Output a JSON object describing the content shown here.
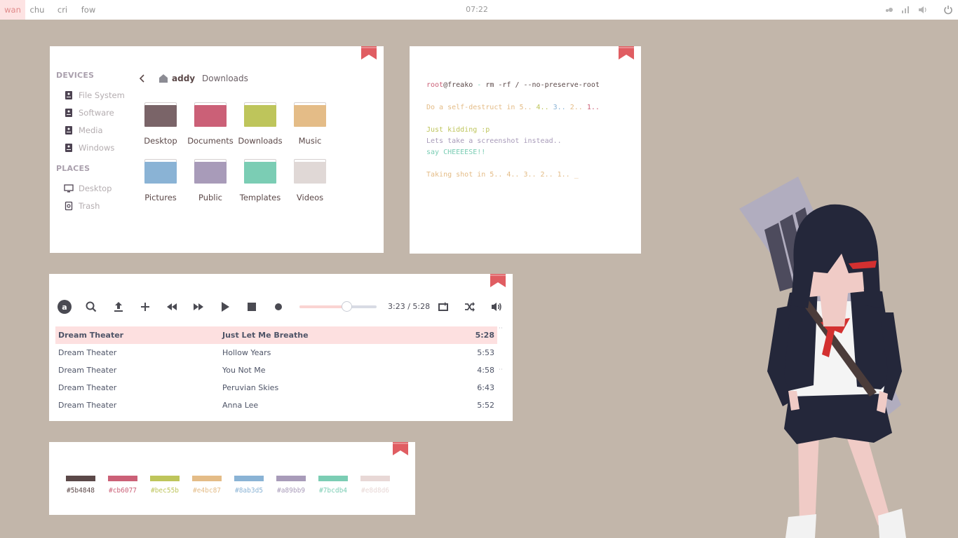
{
  "topbar": {
    "workspaces": [
      "wan",
      "chu",
      "cri",
      "fow"
    ],
    "active_workspace": "wan",
    "clock": "07:22",
    "tray_icons": [
      "network-icon",
      "signal-icon",
      "volume-icon",
      "power-icon"
    ]
  },
  "colors": {
    "background": "#c2b6aa",
    "bookmark": "#e05d62",
    "selected_row": "#fde0e0"
  },
  "file_manager": {
    "sidebar": {
      "devices_header": "DEVICES",
      "devices": [
        "File System",
        "Software",
        "Media",
        "Windows"
      ],
      "places_header": "PLACES",
      "places": [
        "Desktop",
        "Trash"
      ]
    },
    "breadcrumb": {
      "home": "addy",
      "current": "Downloads"
    },
    "folders": [
      {
        "name": "Desktop",
        "color": "#7a6468"
      },
      {
        "name": "Documents",
        "color": "#cb6077"
      },
      {
        "name": "Downloads",
        "color": "#bec55b"
      },
      {
        "name": "Music",
        "color": "#e4bc87"
      },
      {
        "name": "Pictures",
        "color": "#8ab3d5"
      },
      {
        "name": "Public",
        "color": "#a89bb9"
      },
      {
        "name": "Templates",
        "color": "#7bcdb4"
      },
      {
        "name": "Videos",
        "color": "#e0d8d6"
      }
    ]
  },
  "terminal": {
    "prompt_user": "root",
    "prompt_host": "@freako",
    "prompt_sep": " - ",
    "command": "rm -rf / --no-preserve-root",
    "destruct_prefix": "Do a self-destruct in ",
    "destruct_counts": [
      "5..",
      " 4..",
      " 3..",
      " 2..",
      " 1.."
    ],
    "kidding": "Just kidding :p",
    "screenshot_line": "Lets take a screenshot instead..",
    "cheese": "say CHEEEESE!!",
    "shot_line": "Taking shot in 5.. 4.. 3.. 2.. 1.. _"
  },
  "player": {
    "controls": [
      "app-logo-icon",
      "search-icon",
      "upload-icon",
      "add-icon",
      "previous-icon",
      "next-icon",
      "play-icon",
      "stop-icon",
      "record-icon"
    ],
    "progress": 0.61,
    "time": "3:23 / 5:28",
    "right_controls": [
      "repeat-icon",
      "shuffle-icon",
      "speaker-icon"
    ],
    "playlist": [
      {
        "artist": "Dream Theater",
        "title": "Just Let Me Breathe",
        "length": "5:28",
        "active": true
      },
      {
        "artist": "Dream Theater",
        "title": "Hollow Years",
        "length": "5:53"
      },
      {
        "artist": "Dream Theater",
        "title": "You Not Me",
        "length": "4:58"
      },
      {
        "artist": "Dream Theater",
        "title": "Peruvian Skies",
        "length": "6:43"
      },
      {
        "artist": "Dream Theater",
        "title": "Anna Lee",
        "length": "5:52"
      }
    ]
  },
  "palette": [
    {
      "hex": "#5b4848",
      "color": "#5b4848"
    },
    {
      "hex": "#cb6077",
      "color": "#cb6077"
    },
    {
      "hex": "#bec55b",
      "color": "#bec55b"
    },
    {
      "hex": "#e4bc87",
      "color": "#e4bc87"
    },
    {
      "hex": "#8ab3d5",
      "color": "#8ab3d5"
    },
    {
      "hex": "#a89bb9",
      "color": "#a89bb9"
    },
    {
      "hex": "#7bcdb4",
      "color": "#7bcdb4"
    },
    {
      "hex": "#e8d8d6",
      "color": "#e8d8d6"
    }
  ]
}
